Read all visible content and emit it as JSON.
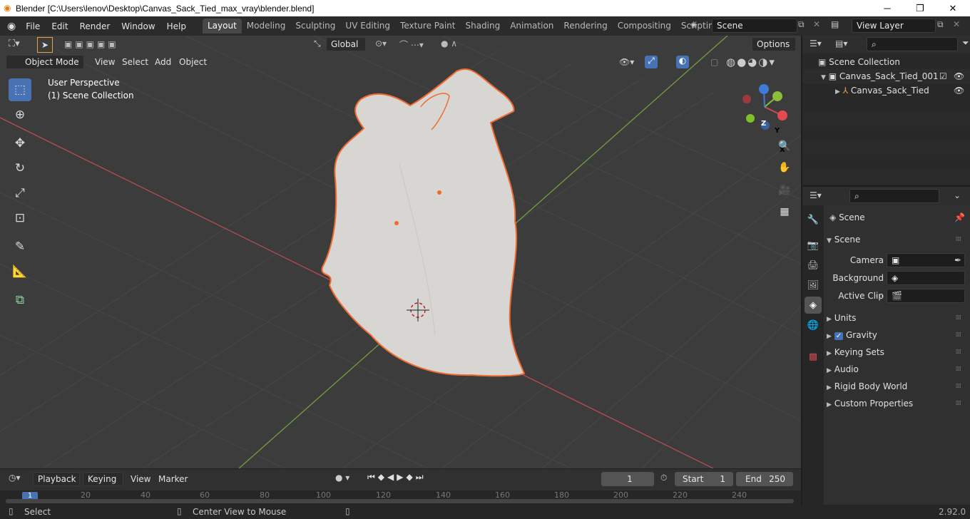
{
  "window": {
    "title": "Blender [C:\\Users\\lenov\\Desktop\\Canvas_Sack_Tied_max_vray\\blender.blend]",
    "minimize": "─",
    "maximize": "❐",
    "close": "✕"
  },
  "menus": [
    "File",
    "Edit",
    "Render",
    "Window",
    "Help"
  ],
  "workspaces": [
    "Layout",
    "Modeling",
    "Sculpting",
    "UV Editing",
    "Texture Paint",
    "Shading",
    "Animation",
    "Rendering",
    "Compositing",
    "Scripting"
  ],
  "active_workspace": "Layout",
  "scene_field": "Scene",
  "view_layer_field": "View Layer",
  "viewport": {
    "mode": "Object Mode",
    "header_menus": [
      "View",
      "Select",
      "Add",
      "Object"
    ],
    "transform_orientation": "Global",
    "options_label": "Options",
    "overlay_title": "User Perspective",
    "overlay_collection": "(1) Scene Collection",
    "gizmo_axes": {
      "x": "X",
      "y": "Y",
      "z": "Z"
    },
    "colors": {
      "background": "#3c3c3c",
      "grid": "#4a4a4a",
      "x_axis": "#b84b4f",
      "y_axis": "#71a039",
      "object": "#d8d6d2",
      "selection": "#f16b31",
      "active_tool": "#4772b3"
    }
  },
  "tools": [
    "select-box-icon",
    "cursor-icon",
    "move-icon",
    "rotate-icon",
    "scale-icon",
    "transform-icon",
    "annotate-icon",
    "measure-icon",
    "add-cube-icon"
  ],
  "outliner": {
    "root": "Scene Collection",
    "collection": "Canvas_Sack_Tied_001",
    "object": "Canvas_Sack_Tied"
  },
  "properties": {
    "context": "Scene",
    "panel": "Scene",
    "fields": [
      {
        "label": "Camera"
      },
      {
        "label": "Background ..."
      },
      {
        "label": "Active Clip"
      }
    ],
    "sections": [
      "Units",
      "Gravity",
      "Keying Sets",
      "Audio",
      "Rigid Body World",
      "Custom Properties"
    ]
  },
  "timeline": {
    "menus": [
      "Playback",
      "Keying",
      "View",
      "Marker"
    ],
    "current_frame": "1",
    "start_label": "Start",
    "start_value": "1",
    "end_label": "End",
    "end_value": "250",
    "ruler": [
      "1",
      "20",
      "40",
      "60",
      "80",
      "100",
      "120",
      "140",
      "160",
      "180",
      "200",
      "220",
      "240"
    ]
  },
  "status": {
    "left": "Select",
    "middle": "Center View to Mouse",
    "version": "2.92.0"
  }
}
